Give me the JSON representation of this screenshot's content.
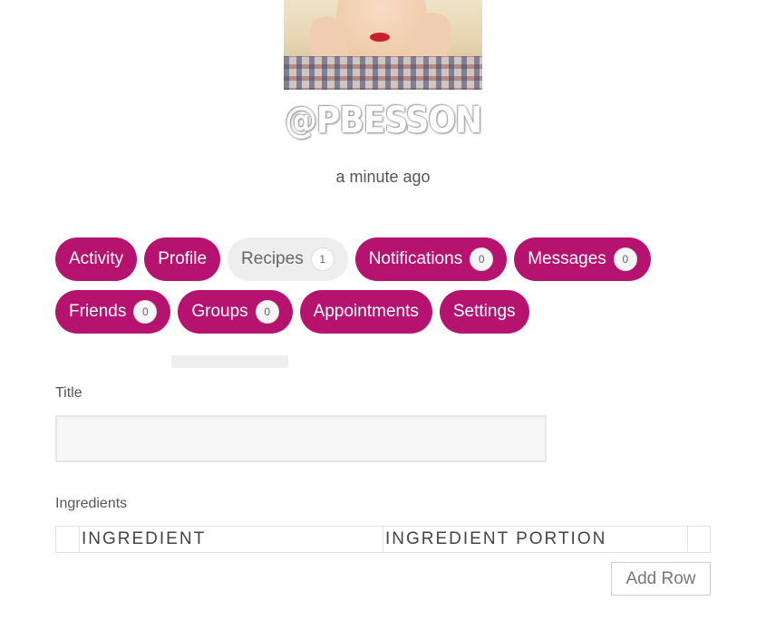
{
  "profile": {
    "username": "@PBESSON",
    "last_active": "a minute ago"
  },
  "nav": {
    "row1": [
      {
        "label": "Activity",
        "count": null
      },
      {
        "label": "Profile",
        "count": null
      },
      {
        "label": "Recipes",
        "count": "1"
      },
      {
        "label": "Notifications",
        "count": "0"
      },
      {
        "label": "Messages",
        "count": "0"
      }
    ],
    "row2": [
      {
        "label": "Friends",
        "count": "0"
      },
      {
        "label": "Groups",
        "count": "0"
      },
      {
        "label": "Appointments",
        "count": null
      },
      {
        "label": "Settings",
        "count": null
      }
    ],
    "active": "Recipes"
  },
  "form": {
    "title_label": "Title",
    "title_value": "",
    "ingredients_label": "Ingredients",
    "columns": [
      "INGREDIENT",
      "INGREDIENT PORTION"
    ],
    "add_row_label": "Add Row"
  },
  "colors": {
    "accent": "#b5136f",
    "active_tab": "#eeeeee"
  }
}
